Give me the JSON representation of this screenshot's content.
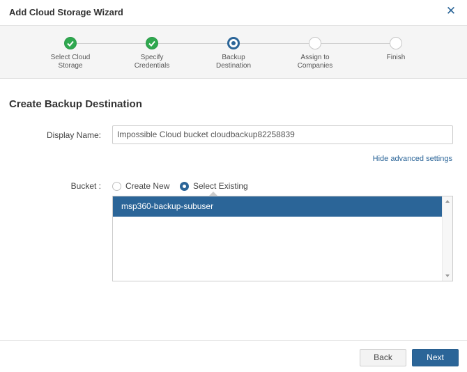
{
  "dialog": {
    "title": "Add Cloud Storage Wizard",
    "close_icon": "close-icon"
  },
  "steps": [
    {
      "label_line1": "Select Cloud",
      "label_line2": "Storage",
      "status": "done"
    },
    {
      "label_line1": "Specify",
      "label_line2": "Credentials",
      "status": "done"
    },
    {
      "label_line1": "Backup",
      "label_line2": "Destination",
      "status": "active"
    },
    {
      "label_line1": "Assign to",
      "label_line2": "Companies",
      "status": "pending"
    },
    {
      "label_line1": "Finish",
      "label_line2": "",
      "status": "pending"
    }
  ],
  "main": {
    "section_title": "Create Backup Destination",
    "display_name_label": "Display Name:",
    "display_name_value": "Impossible Cloud bucket cloudbackup82258839",
    "advanced_link": "Hide advanced settings",
    "bucket_label": "Bucket :",
    "radio_create_new": "Create New",
    "radio_select_existing": "Select Existing",
    "selected_option": "Select Existing",
    "buckets": [
      "msp360-backup-subuser"
    ]
  },
  "footer": {
    "back_label": "Back",
    "next_label": "Next"
  },
  "colors": {
    "accent": "#2b6598",
    "done": "#2fa84f"
  }
}
